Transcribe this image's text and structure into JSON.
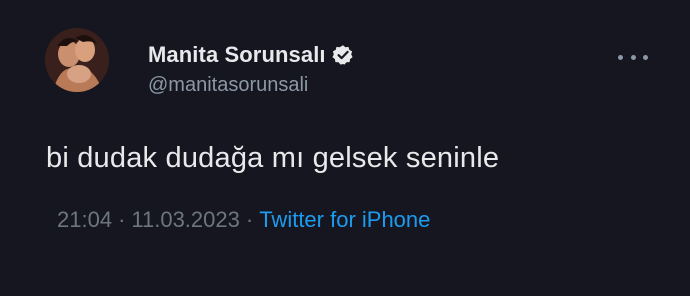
{
  "tweet": {
    "author": {
      "display_name": "Manita Sorunsalı",
      "handle": "@manitasorunsali",
      "verified": true,
      "avatar_icon": "profile-photo"
    },
    "text": "bi dudak dudağa mı gelsek seninle",
    "time": "21:04",
    "date": "11.03.2023",
    "separator": "·",
    "source": "Twitter for iPhone",
    "more_icon": "more-dots-icon"
  },
  "colors": {
    "background": "#15161f",
    "text_primary": "#e7e9ea",
    "text_secondary": "#8b98a5",
    "link": "#1d9bf0",
    "verified_badge": "#e7e9ea"
  }
}
